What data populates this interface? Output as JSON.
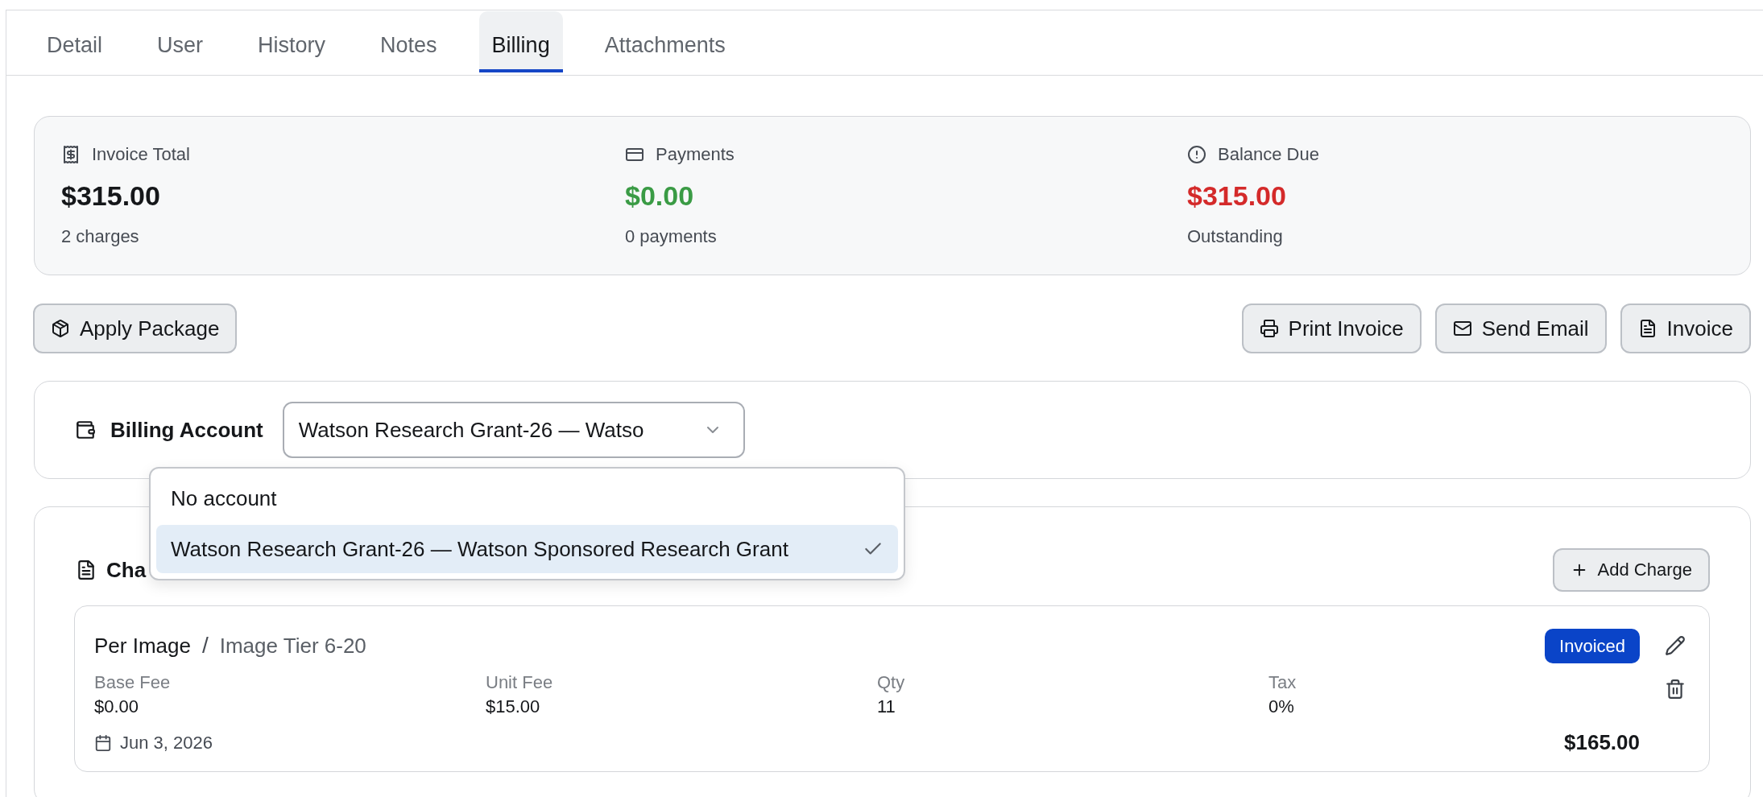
{
  "tabs": [
    {
      "label": "Detail",
      "selected": false
    },
    {
      "label": "User",
      "selected": false
    },
    {
      "label": "History",
      "selected": false
    },
    {
      "label": "Notes",
      "selected": false
    },
    {
      "label": "Billing",
      "selected": true
    },
    {
      "label": "Attachments",
      "selected": false
    }
  ],
  "summary": [
    {
      "kind": "total",
      "label": "Invoice Total",
      "value": "$315.00",
      "note": "2 charges"
    },
    {
      "kind": "payments",
      "label": "Payments",
      "value": "$0.00",
      "note": "0 payments"
    },
    {
      "kind": "balance",
      "label": "Balance Due",
      "value": "$315.00",
      "note": "Outstanding"
    }
  ],
  "actions": {
    "left": [
      {
        "kind": "package",
        "label": "Apply Package"
      }
    ],
    "right": [
      {
        "kind": "print",
        "label": "Print Invoice"
      },
      {
        "kind": "email",
        "label": "Send Email"
      },
      {
        "kind": "document",
        "label": "Invoice"
      }
    ]
  },
  "billing_account": {
    "label": "Billing Account",
    "value": "Watson Research Grant-26 — Watso",
    "expanded": true,
    "options": [
      {
        "label": "No account",
        "selected": false
      },
      {
        "label": "Watson Research Grant-26 — Watson Sponsored Research Grant",
        "selected": true
      }
    ]
  },
  "charges": {
    "title": "Cha",
    "add_button": "Add Charge",
    "items": [
      {
        "name": "Per Image",
        "separator": "/",
        "tier": "Image Tier 6-20",
        "status": "Invoiced",
        "fields": [
          {
            "label": "Base Fee",
            "value": "$0.00"
          },
          {
            "label": "Unit Fee",
            "value": "$15.00"
          },
          {
            "label": "Qty",
            "value": "11"
          },
          {
            "label": "Tax",
            "value": "0%"
          }
        ],
        "date": "Jun 3, 2026",
        "amount": "$165.00"
      }
    ]
  }
}
